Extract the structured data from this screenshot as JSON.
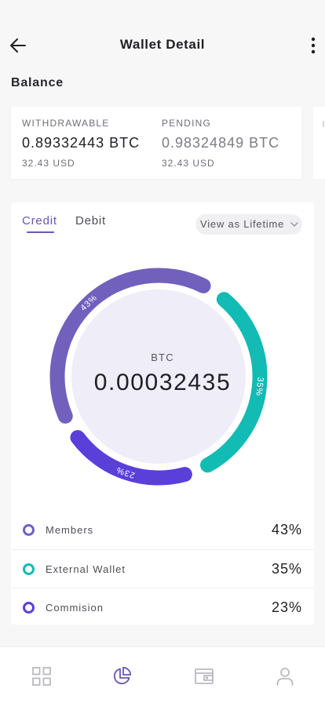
{
  "header": {
    "title": "Wallet Detail"
  },
  "balance": {
    "section_title": "Balance",
    "withdrawable": {
      "label": "WITHDRAWABLE",
      "value": "0.89332443 BTC",
      "usd": "32.43 USD"
    },
    "pending": {
      "label": "PENDING",
      "value": "0.98324849 BTC",
      "usd": "32.43 USD"
    }
  },
  "tabs": {
    "credit": "Credit",
    "debit": "Debit",
    "active": "Credit"
  },
  "filter": {
    "selected": "View as Lifetime"
  },
  "donut": {
    "center_label": "BTC",
    "center_value": "0.00032435",
    "segments": [
      {
        "label": "43%",
        "percent": 43,
        "color": "#7260bd"
      },
      {
        "label": "35%",
        "percent": 35,
        "color": "#12bbb3"
      },
      {
        "label": "23%",
        "percent": 23,
        "color": "#5a3fd9"
      }
    ]
  },
  "legend": [
    {
      "label": "Members",
      "pct": "43%",
      "color": "#7260bd"
    },
    {
      "label": "External Wallet",
      "pct": "35%",
      "color": "#12bbb3"
    },
    {
      "label": "Commision",
      "pct": "23%",
      "color": "#5a3fd9"
    }
  ],
  "nav": {
    "items": [
      {
        "icon": "grid-icon"
      },
      {
        "icon": "pie-chart-icon",
        "active": true
      },
      {
        "icon": "wallet-icon"
      },
      {
        "icon": "user-icon"
      }
    ],
    "active_color": "#6b55b4",
    "inactive_color": "#b9b9c0"
  }
}
